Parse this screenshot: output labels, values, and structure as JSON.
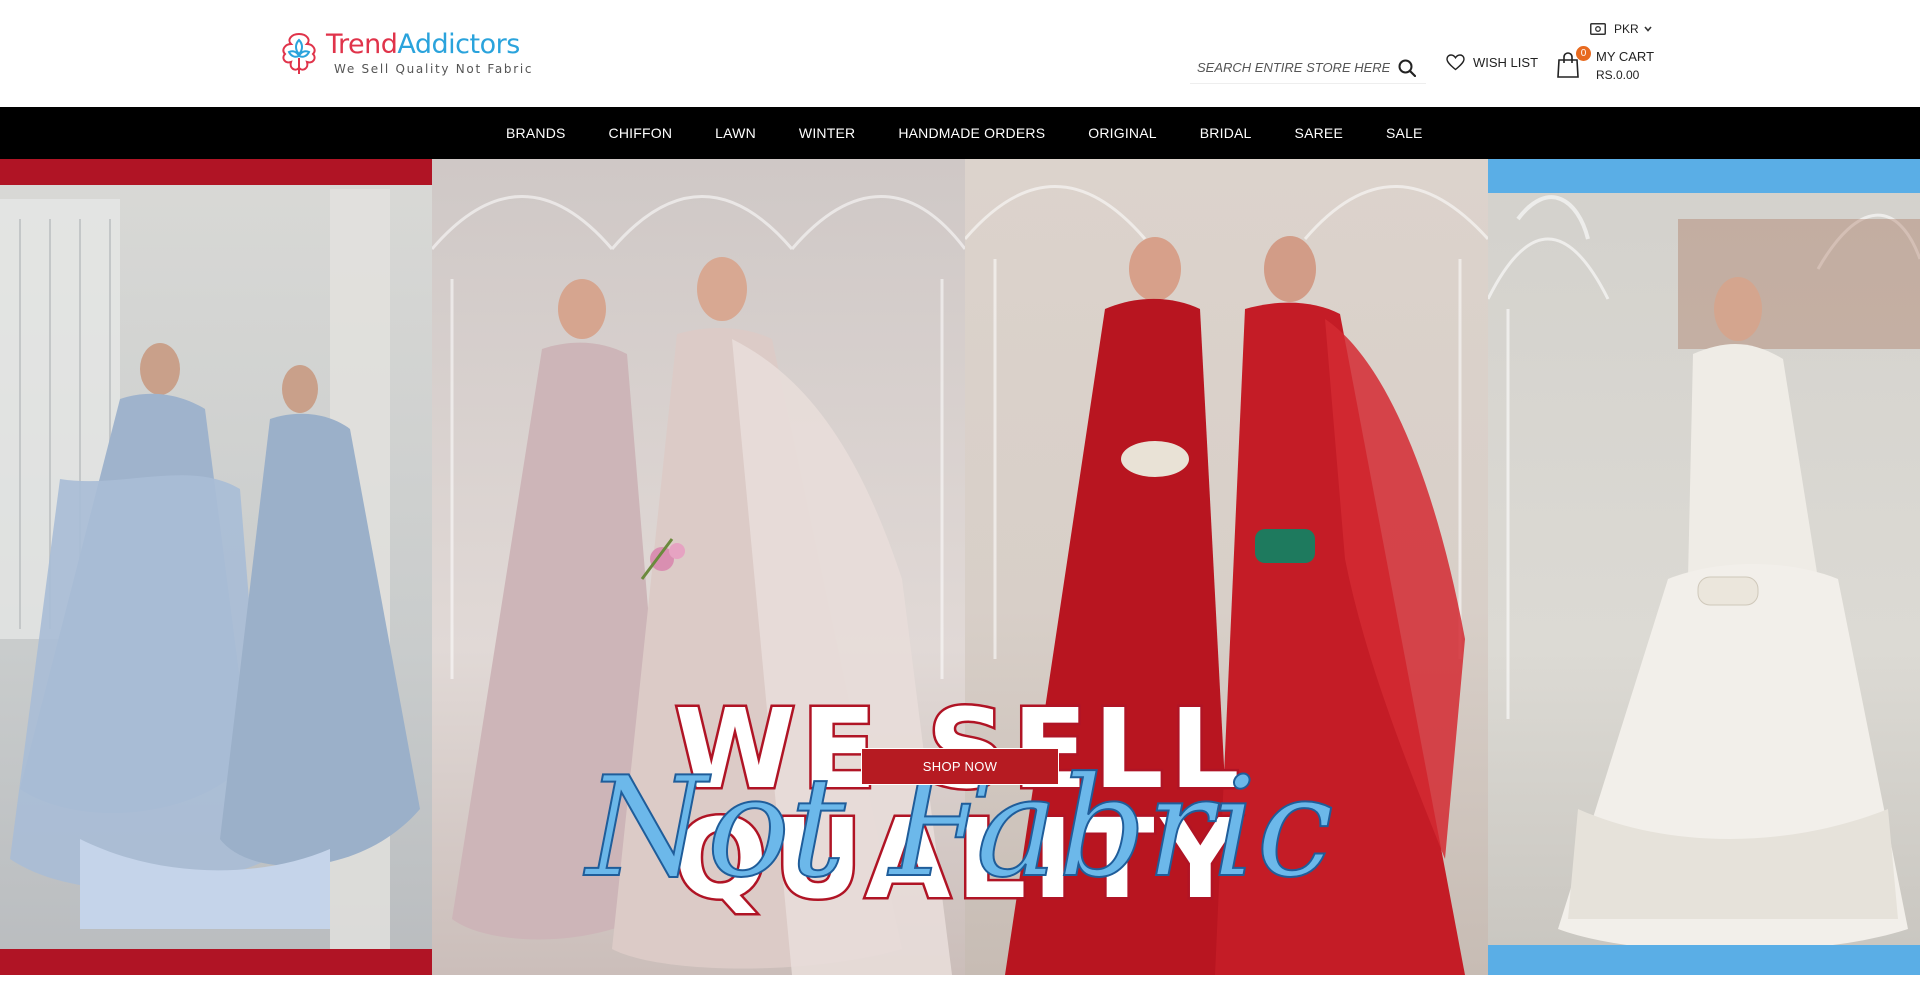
{
  "brand": {
    "name_part1": "Trend",
    "name_part2": "Addictors",
    "tagline": "We Sell Quality Not Fabric",
    "primary_red": "#e0334a",
    "primary_blue": "#2aa3dc"
  },
  "currency": {
    "icon": "money-icon",
    "selected": "PKR"
  },
  "search": {
    "placeholder": "SEARCH ENTIRE STORE HERE..."
  },
  "wishlist": {
    "label": "WISH LIST",
    "icon": "heart-icon"
  },
  "cart": {
    "label": "MY CART",
    "total": "RS.0.00",
    "count": "0",
    "icon": "shopping-bag-icon"
  },
  "nav": {
    "items": [
      "BRANDS",
      "CHIFFON",
      "LAWN",
      "WINTER",
      "HANDMADE ORDERS",
      "ORIGINAL",
      "BRIDAL",
      "SAREE",
      "SALE"
    ]
  },
  "hero": {
    "headline": "WE SELL QUALITY",
    "script": "Not Fabric",
    "cta": "SHOP NOW",
    "colors": {
      "red_band": "#b01425",
      "blue_band": "#5aaee6",
      "cta_bg": "#b61b22"
    }
  }
}
